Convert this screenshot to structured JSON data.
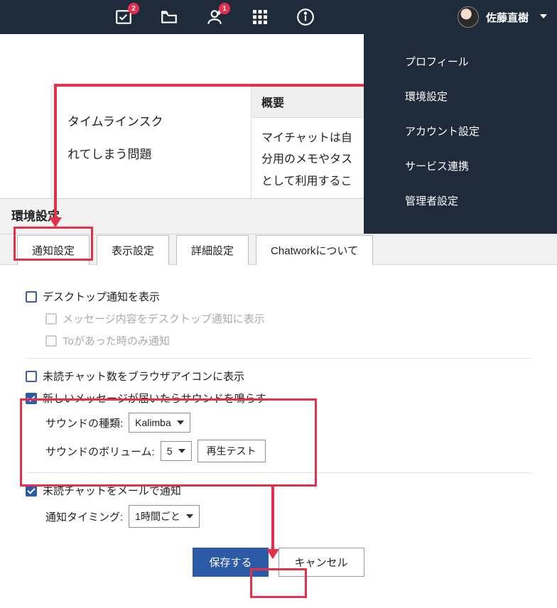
{
  "header": {
    "badges": {
      "tasks": "2",
      "invite": "1"
    },
    "username": "佐藤直樹"
  },
  "usermenu": {
    "items": [
      "プロフィール",
      "環境設定",
      "アカウント設定",
      "サービス連携",
      "管理者設定"
    ]
  },
  "bg": {
    "left_line1": "タイムラインスク",
    "left_line2": "れてしまう問題",
    "right_head": "概要",
    "right_body": "マイチャットは自\n分用のメモやタス\nとして利用するこ"
  },
  "modal": {
    "title": "環境設定",
    "tabs": [
      "通知設定",
      "表示設定",
      "詳細設定",
      "Chatworkについて"
    ],
    "opt_desktop": "デスクトップ通知を表示",
    "opt_desktop_sub1": "メッセージ内容をデスクトップ通知に表示",
    "opt_desktop_sub2": "Toがあった時のみ通知",
    "opt_badge": "未読チャット数をブラウザアイコンに表示",
    "opt_sound": "新しいメッセージが届いたらサウンドを鳴らす",
    "label_sound_type": "サウンドの種類:",
    "val_sound_type": "Kalimba",
    "label_sound_vol": "サウンドのボリューム:",
    "val_sound_vol": "5",
    "btn_playtest": "再生テスト",
    "opt_email": "未読チャットをメールで通知",
    "label_email_timing": "通知タイミング:",
    "val_email_timing": "1時間ごと",
    "btn_save": "保存する",
    "btn_cancel": "キャンセル"
  }
}
